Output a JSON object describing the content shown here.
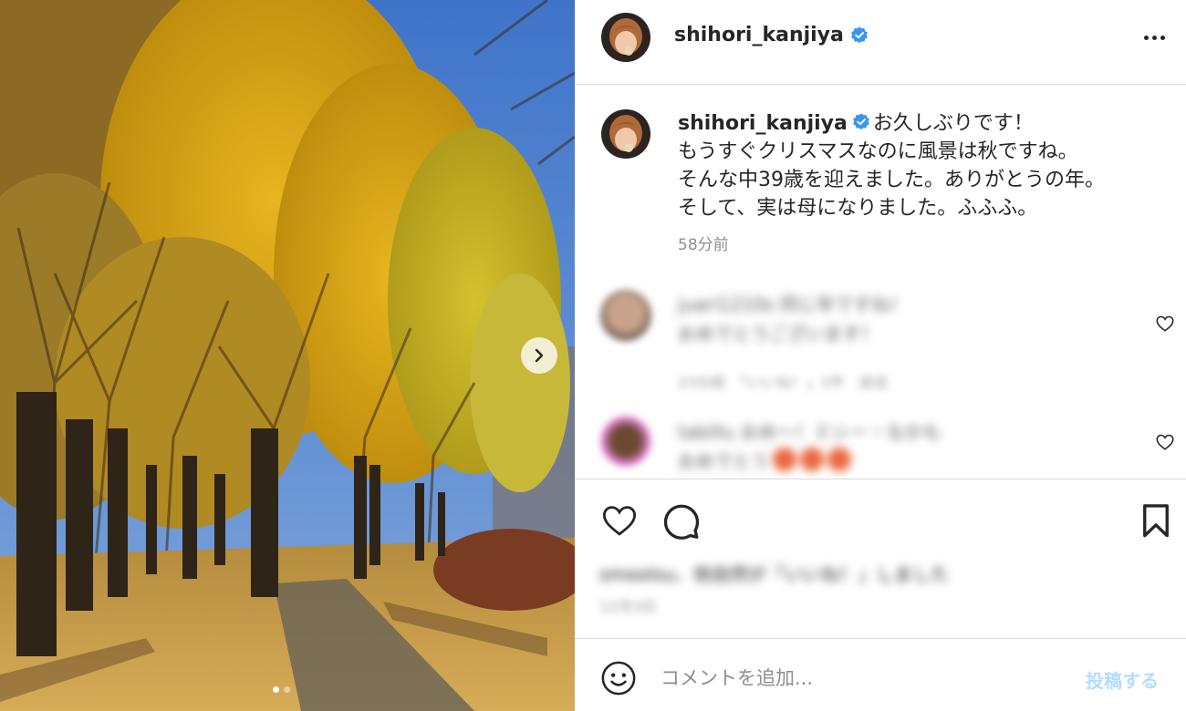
{
  "post": {
    "username": "shihori_kanjiya",
    "verified": true,
    "caption_lines": [
      "お久しぶりです！",
      "もうすぐクリスマスなのに風景は秋ですね。",
      "そんな中39歳を迎えました。ありがとうの年。",
      "そして、実は母になりました。ふふふ。"
    ],
    "time_ago": "58分前",
    "comment_placeholder": "コメントを追加...",
    "post_button": "投稿する"
  },
  "carousel": {
    "current": 1,
    "total": 2
  },
  "comments": [
    {
      "text_line1": "juari1210s 同じ年ですね！",
      "text_line2": "おめでとうございます！",
      "meta": "23分前　「いいね！」1件　返信"
    },
    {
      "text_line1": "tabillu おめ～！ミシー・なかも",
      "text_line2": "おめでとう"
    }
  ],
  "likes_line": "smoolsu、他自然が「いいね！」しました",
  "date_line": "12月3日",
  "colors": {
    "verified": "#3897f0",
    "border": "#dbdbdb",
    "muted": "#8e8e8e",
    "post_button": "#b3dbff"
  },
  "icons": [
    "verified-icon",
    "more-icon",
    "chevron-right-icon",
    "heart-icon",
    "comment-icon",
    "bookmark-icon",
    "emoji-icon"
  ]
}
